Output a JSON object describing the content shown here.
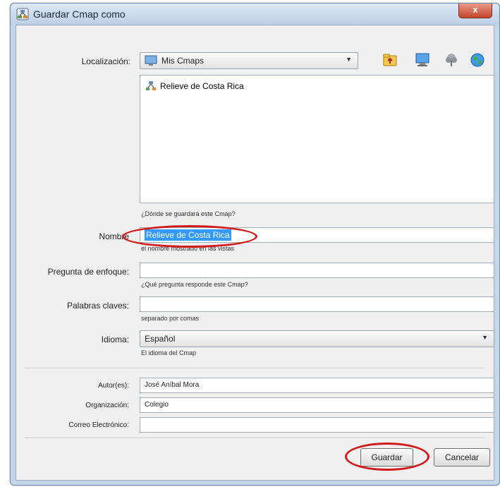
{
  "window": {
    "title": "Guardar Cmap como",
    "close_glyph": "x"
  },
  "location": {
    "label": "Localización:",
    "value": "Mis Cmaps",
    "icons": [
      "folder-up-icon",
      "computer-icon",
      "server-tree-icon",
      "globe-icon"
    ]
  },
  "files": [
    {
      "label": "Relieve de Costa Rica",
      "icon": "cmap-icon"
    }
  ],
  "location_hint": "¿Dónde se guardará este Cmap?",
  "name": {
    "label": "Nombre",
    "value": "Relieve de Costa Rica",
    "hint": "el nombre mostrado en las vistas"
  },
  "focus_question": {
    "label": "Pregunta de enfoque:",
    "value": "",
    "hint": "¿Qué pregunta responde este Cmap?"
  },
  "keywords": {
    "label": "Palabras claves:",
    "value": "",
    "hint": "separado por comas"
  },
  "language": {
    "label": "Idioma:",
    "value": "Español",
    "hint": "El idioma del Cmap"
  },
  "authors": {
    "label": "Autor(es):",
    "value": "José Aníbal Mora"
  },
  "organization": {
    "label": "Organización:",
    "value": "Colegio"
  },
  "email": {
    "label": "Correo Electrónico:",
    "value": ""
  },
  "buttons": {
    "save": "Guardar",
    "cancel": "Cancelar"
  },
  "colors": {
    "highlight": "#3399ff",
    "annotation": "#d11a1a",
    "titlebar": "#c4d6ea"
  }
}
